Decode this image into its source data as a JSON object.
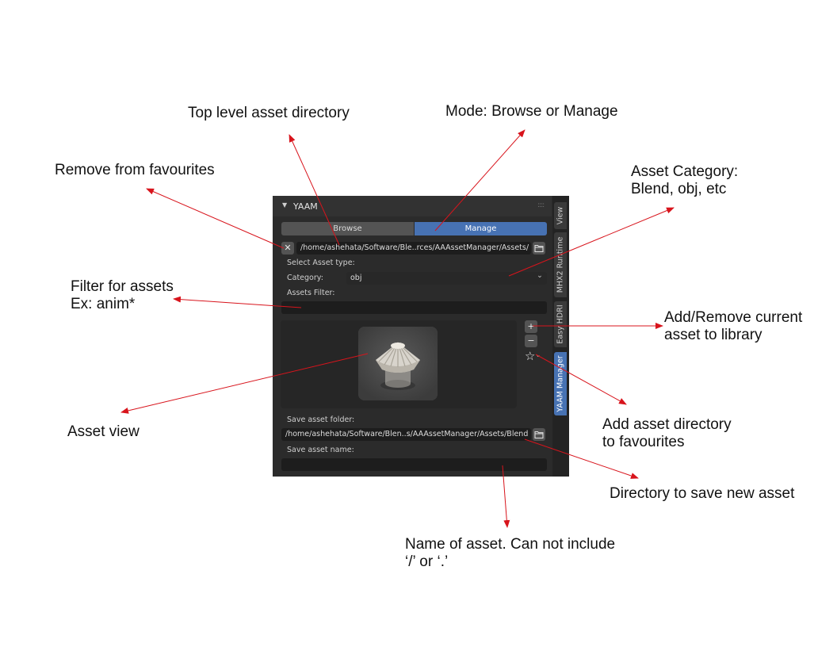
{
  "annotations": {
    "top_level_dir": "Top level asset directory",
    "mode": "Mode: Browse or Manage",
    "remove_fav": "Remove from favourites",
    "asset_category_line1": "Asset Category:",
    "asset_category_line2": "Blend, obj, etc",
    "filter_line1": "Filter for assets",
    "filter_line2": "Ex: anim*",
    "add_remove_line1": "Add/Remove current",
    "add_remove_line2": "asset to library",
    "asset_view": "Asset view",
    "add_fav_line1": "Add asset directory",
    "add_fav_line2": "to favourites",
    "save_dir": "Directory to save new asset",
    "name_line1": "Name of asset. Can not include",
    "name_line2": "‘/’ or ‘.’"
  },
  "panel": {
    "title": "YAAM",
    "tabs": [
      "Browse",
      "Manage"
    ],
    "active_tab": "Manage",
    "top_dir": "/home/ashehata/Software/Ble..rces/AAAssetManager/Assets/",
    "select_asset_type_label": "Select Asset type:",
    "category_label": "Category:",
    "category_value": "obj",
    "assets_filter_label": "Assets Filter:",
    "assets_filter_value": "",
    "save_folder_label": "Save asset folder:",
    "save_folder_value": "/home/ashehata/Software/Blen..s/AAAssetManager/Assets/Blend",
    "save_name_label": "Save asset name:",
    "save_name_value": "",
    "plus": "+",
    "minus": "−",
    "remove_fav_glyph": "✕",
    "star_glyph": "☆",
    "dropdown_glyph": "⌄"
  },
  "side_tabs": [
    "View",
    "MHX2 Runtime",
    "Easy HDRI",
    "YAAM Manager"
  ],
  "active_side_tab": "YAAM Manager",
  "colors": {
    "arrow": "#d8141c",
    "accent": "#4772b3",
    "panel_bg": "#2b2b2b",
    "field_bg": "#1d1d1d"
  }
}
